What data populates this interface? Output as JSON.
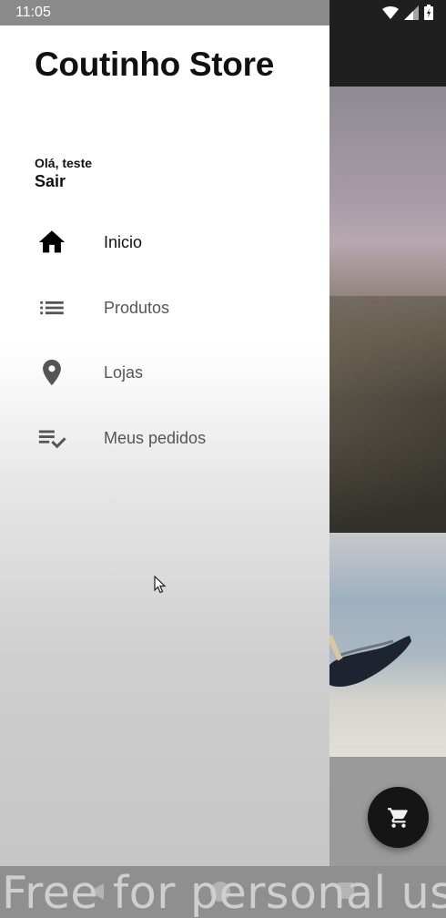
{
  "status_bar": {
    "time": "11:05"
  },
  "drawer": {
    "title": "Coutinho Store",
    "greeting": "Olá, teste",
    "logout_label": "Sair",
    "items": [
      {
        "label": "Inicio",
        "icon": "home-icon",
        "selected": true
      },
      {
        "label": "Produtos",
        "icon": "list-icon",
        "selected": false
      },
      {
        "label": "Lojas",
        "icon": "location-pin-icon",
        "selected": false
      },
      {
        "label": "Meus pedidos",
        "icon": "playlist-check-icon",
        "selected": false
      }
    ]
  },
  "fab": {
    "icon": "cart-icon"
  },
  "watermark": "Free for personal use",
  "colors": {
    "selected_text": "#111111",
    "unselected_text": "#555555",
    "selected_icon": "#000000",
    "unselected_icon": "#555555"
  }
}
